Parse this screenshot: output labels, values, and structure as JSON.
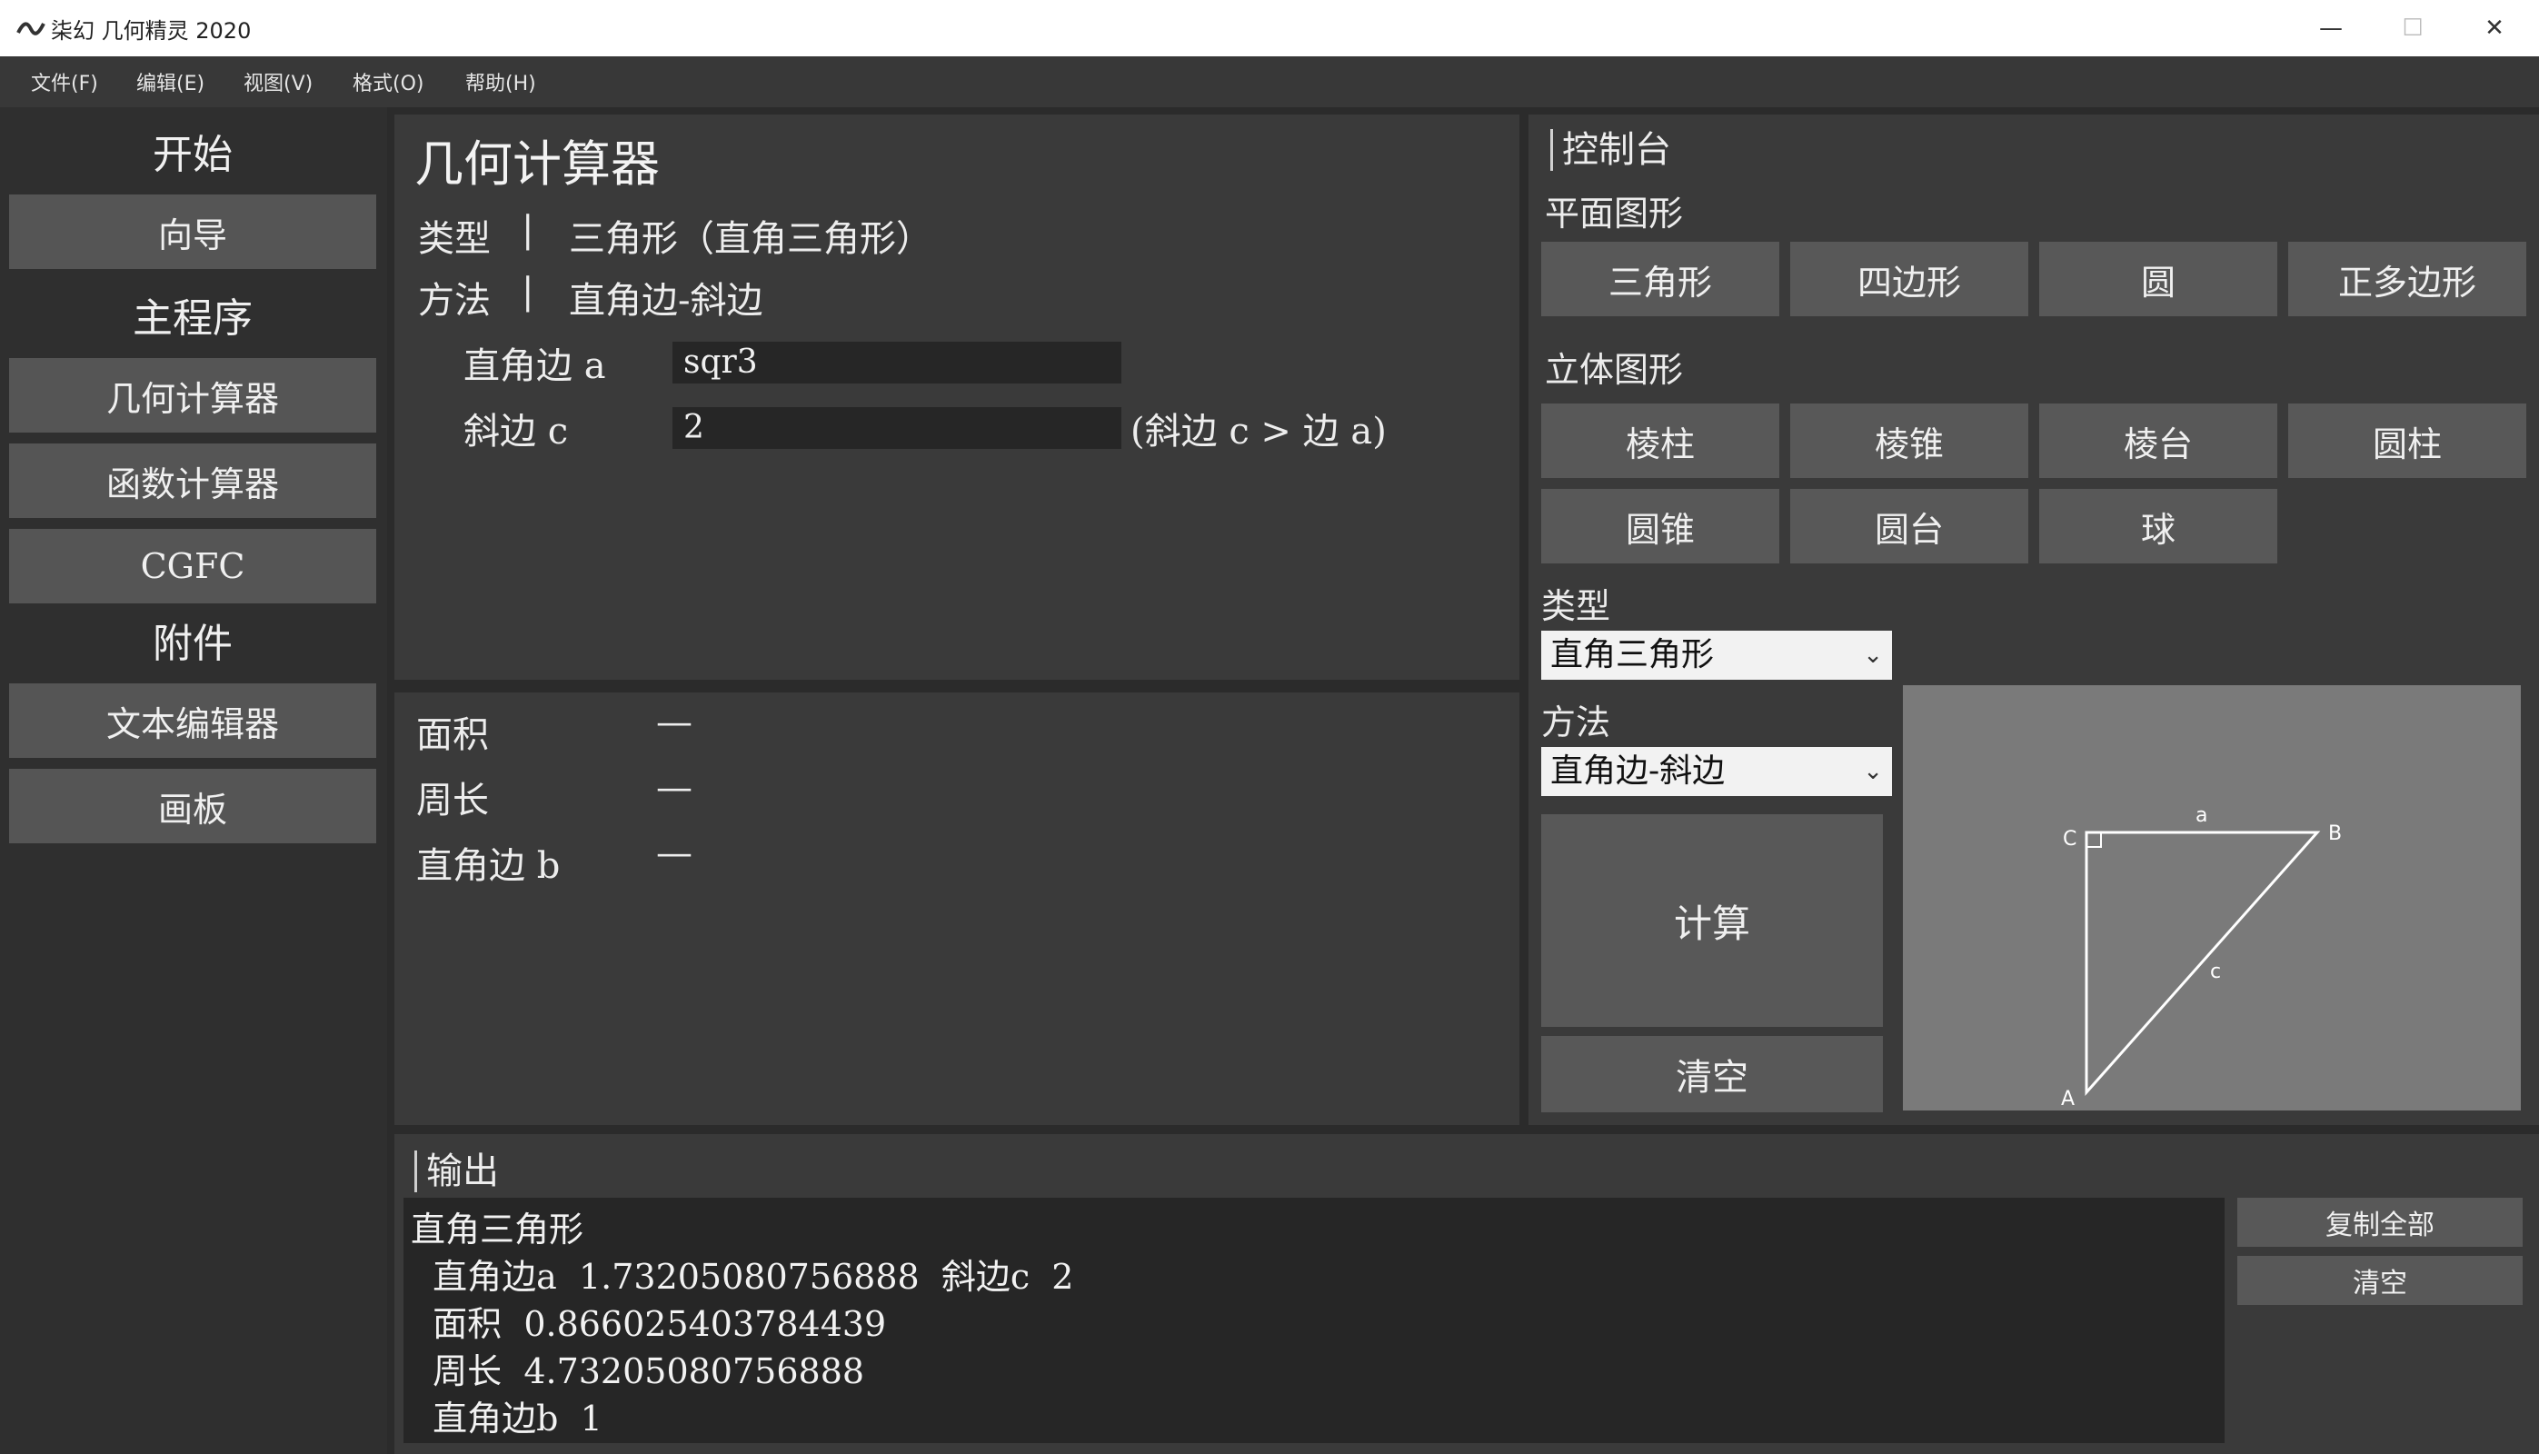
{
  "window": {
    "title": "柒幻 几何精灵 2020",
    "minimize_symbol": "—",
    "maximize_symbol": "☐",
    "close_symbol": "✕"
  },
  "menu": [
    "文件(F)",
    "编辑(E)",
    "视图(V)",
    "格式(O)",
    "帮助(H)"
  ],
  "sidebar": {
    "start_label": "开始",
    "guide_label": "向导",
    "main_label": "主程序",
    "geo_calc_label": "几何计算器",
    "func_calc_label": "函数计算器",
    "cgfc_label": "CGFC",
    "attachments_label": "附件",
    "text_editor_label": "文本编辑器",
    "canvas_label": "画板"
  },
  "calculator": {
    "title": "几何计算器",
    "type_label": "类型",
    "type_value": "三角形（直角三角形）",
    "method_label": "方法",
    "method_value": "直角边-斜边",
    "separator": "|",
    "inputs": [
      {
        "label": "直角边 a",
        "value": "sqr3",
        "note": ""
      },
      {
        "label": "斜边 c",
        "value": "2",
        "note": "(斜边 c > 边 a)"
      }
    ]
  },
  "results": [
    {
      "label": "面积",
      "value": "—"
    },
    {
      "label": "周长",
      "value": "—"
    },
    {
      "label": "直角边 b",
      "value": "—"
    }
  ],
  "console": {
    "title": "控制台",
    "plane_label": "平面图形",
    "plane_shapes": [
      "三角形",
      "四边形",
      "圆",
      "正多边形"
    ],
    "solid_label": "立体图形",
    "solid_shapes_row1": [
      "棱柱",
      "棱锥",
      "棱台",
      "圆柱"
    ],
    "solid_shapes_row2": [
      "圆锥",
      "圆台",
      "球"
    ],
    "type_label": "类型",
    "type_selected": "直角三角形",
    "method_label": "方法",
    "method_selected": "直角边-斜边",
    "calc_button": "计算",
    "clear_button": "清空",
    "diagram_labels": {
      "a": "a",
      "b": "B",
      "c": "c",
      "A": "A",
      "C": "C"
    }
  },
  "output": {
    "title": "输出",
    "lines": [
      "直角三角形",
      "  直角边a  1.73205080756888  斜边c  2",
      "  面积  0.866025403784439",
      "  周长  4.73205080756888",
      "  直角边b  1"
    ],
    "copy_all_button": "复制全部",
    "clear_button": "清空"
  },
  "colors": {
    "background": "#2b2b2b",
    "panel": "#3a3a3a",
    "button": "#585858",
    "input": "#262626",
    "diagram_bg": "#7a7a7a"
  }
}
